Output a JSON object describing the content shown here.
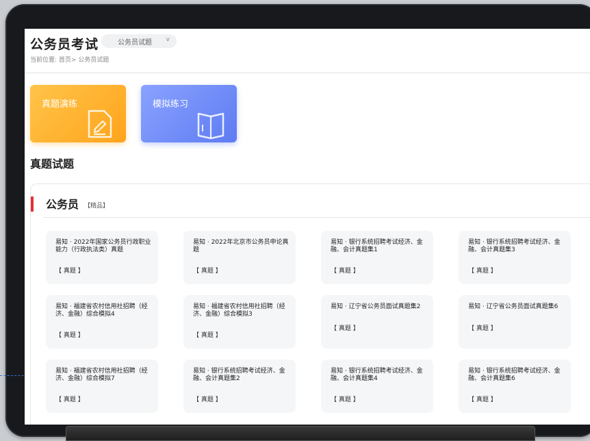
{
  "header": {
    "title": "公务员考试",
    "category_select": "公务员试题",
    "breadcrumb": "当前位置: 首页> 公务员试题"
  },
  "practice": {
    "real_label": "真题演练",
    "mock_label": "模拟练习"
  },
  "section": {
    "title": "真题试题"
  },
  "panel": {
    "title": "公务员",
    "tag": "【精品】",
    "items": [
      {
        "title": "易知 · 2022年国家公务员行政职业能力（行政执法类）真题",
        "tag": "【 真题 】"
      },
      {
        "title": "易知 · 2022年北京市公务员申论真题",
        "tag": "【 真题 】"
      },
      {
        "title": "易知 · 银行系统招聘考试经济、金融、会计真题集1",
        "tag": "【 真题 】"
      },
      {
        "title": "易知 · 银行系统招聘考试经济、金融、会计真题集3",
        "tag": "【 真题 】"
      },
      {
        "title": "易知 · 福建省农村信用社招聘（经济、金融）综合模拟4",
        "tag": "【 真题 】"
      },
      {
        "title": "易知 · 福建省农村信用社招聘（经济、金融）综合模拟3",
        "tag": "【 真题 】"
      },
      {
        "title": "易知 · 辽宁省公务员面试真题集2",
        "tag": "【 真题 】"
      },
      {
        "title": "易知 · 辽宁省公务员面试真题集6",
        "tag": "【 真题 】"
      },
      {
        "title": "易知 · 福建省农村信用社招聘（经济、金融）综合模拟7",
        "tag": "【 真题 】"
      },
      {
        "title": "易知 · 银行系统招聘考试经济、金融、会计真题集2",
        "tag": "【 真题 】"
      },
      {
        "title": "易知 · 银行系统招聘考试经济、金融、会计真题集4",
        "tag": "【 真题 】"
      },
      {
        "title": "易知 · 银行系统招聘考试经济、金融、会计真题集6",
        "tag": "【 真题 】"
      }
    ]
  },
  "colors": {
    "accent_red": "#e03131",
    "real_card": "#ffb02e",
    "mock_card": "#6f8cf6"
  },
  "icons": {
    "real_card_icon": "document-edit-icon",
    "mock_card_icon": "open-book-icon",
    "select_icon": "chevron-down-icon"
  }
}
